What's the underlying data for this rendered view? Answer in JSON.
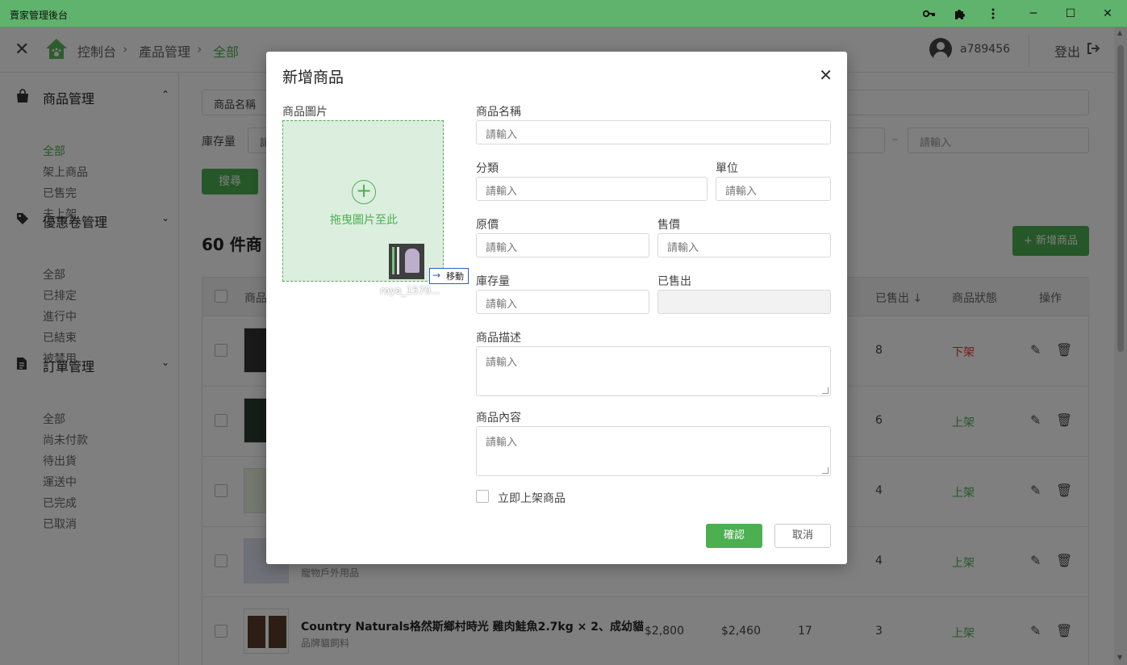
{
  "window": {
    "title": "賣家管理後台",
    "key_icon": "key-icon",
    "puzzle_icon": "puzzle-icon",
    "menu_icon": "kebab-menu-icon",
    "minimize": "─",
    "maximize": "☐",
    "close": "✕"
  },
  "header": {
    "close_symbol": "✕",
    "breadcrumb": [
      "控制台",
      "產品管理",
      "全部"
    ],
    "username": "a789456",
    "logout": "登出"
  },
  "sidebar": {
    "sections": [
      {
        "title": "商品管理",
        "icon": "shopping-bag-icon",
        "items": [
          "全部",
          "架上商品",
          "已售完",
          "未上架"
        ]
      },
      {
        "title": "優惠卷管理",
        "icon": "tag-icon",
        "items": [
          "全部",
          "已排定",
          "進行中",
          "已結束",
          "被禁用"
        ]
      },
      {
        "title": "訂單管理",
        "icon": "document-icon",
        "items": [
          "全部",
          "尚未付款",
          "待出貨",
          "運送中",
          "已完成",
          "已取消"
        ]
      }
    ]
  },
  "filters": {
    "name_label": "商品名稱",
    "stock_label": "庫存量",
    "stock_min_placeholder": "請",
    "range_right_placeholder": "請輸入",
    "search_button": "搜尋",
    "dash": "–"
  },
  "main": {
    "count_text": "60 件商",
    "add_button": "+ 新增商品"
  },
  "table": {
    "headers": {
      "product": "商品",
      "sold": "已售出 ↓",
      "status": "商品狀態",
      "action": "操作"
    },
    "rows": [
      {
        "sold": "8",
        "status": "下架",
        "status_color": "#e53935"
      },
      {
        "sold": "6",
        "status": "上架",
        "status_color": "#4caf50"
      },
      {
        "sold": "4",
        "status": "上架",
        "status_color": "#4caf50"
      },
      {
        "category": "寵物戶外用品",
        "sold": "4",
        "status": "上架",
        "status_color": "#4caf50"
      },
      {
        "name": "Country Naturals格然斯鄉村時光 雞肉鮭魚2.7kg × 2、成幼貓",
        "category": "品牌貓飼料",
        "price": "$2,800",
        "sale_price": "$2,460",
        "stock": "17",
        "sold": "3",
        "status": "上架",
        "status_color": "#4caf50"
      }
    ]
  },
  "modal": {
    "title": "新增商品",
    "close_symbol": "✕",
    "image_label": "商品圖片",
    "drop_text": "拖曳圖片至此",
    "drag_file_name": "roya_1570...",
    "move_tip": "移動",
    "name_label": "商品名稱",
    "category_label": "分類",
    "unit_label": "單位",
    "orig_price_label": "原價",
    "sale_price_label": "售價",
    "stock_label": "庫存量",
    "sold_label": "已售出",
    "desc_label": "商品描述",
    "content_label": "商品內容",
    "placeholder": "請輸入",
    "publish_label": "立即上架商品",
    "confirm": "確認",
    "cancel": "取消"
  },
  "colors": {
    "accent": "#4caf50",
    "titlebar": "#5fb36c",
    "danger": "#e53935"
  }
}
